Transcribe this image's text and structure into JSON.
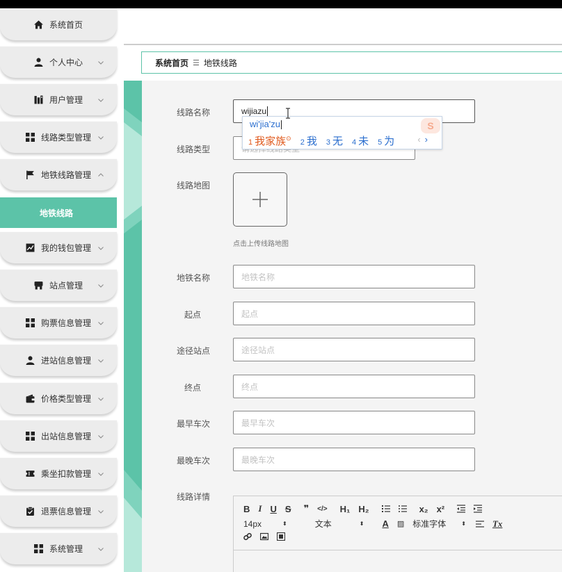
{
  "sidebar": {
    "items": [
      {
        "label": "系统首页",
        "icon": "home-icon",
        "expandable": false
      },
      {
        "label": "个人中心",
        "icon": "user-icon",
        "expandable": true
      },
      {
        "label": "用户管理",
        "icon": "building-icon",
        "expandable": true
      },
      {
        "label": "线路类型管理",
        "icon": "grid-icon",
        "expandable": true
      },
      {
        "label": "地铁线路管理",
        "icon": "flag-icon",
        "expandable": true,
        "expanded": true
      },
      {
        "label": "我的钱包管理",
        "icon": "chart-icon",
        "expandable": true
      },
      {
        "label": "站点管理",
        "icon": "store-icon",
        "expandable": true
      },
      {
        "label": "购票信息管理",
        "icon": "grid-icon",
        "expandable": true
      },
      {
        "label": "进站信息管理",
        "icon": "user-icon",
        "expandable": true
      },
      {
        "label": "价格类型管理",
        "icon": "wallet-icon",
        "expandable": true
      },
      {
        "label": "出站信息管理",
        "icon": "grid-icon",
        "expandable": true
      },
      {
        "label": "乘坐扣款管理",
        "icon": "ticket-icon",
        "expandable": true
      },
      {
        "label": "退票信息管理",
        "icon": "clipboard-icon",
        "expandable": true
      },
      {
        "label": "系统管理",
        "icon": "grid-icon",
        "expandable": true
      }
    ],
    "active_sub": "地铁线路"
  },
  "breadcrumb": {
    "home": "系统首页",
    "separator": "☰",
    "current": "地铁线路"
  },
  "form": {
    "fields": {
      "line_name": {
        "label": "线路名称",
        "value": "wijiazu"
      },
      "line_type": {
        "label": "线路类型",
        "placeholder": "请选择线路类型"
      },
      "line_map": {
        "label": "线路地图",
        "tip": "点击上传线路地图"
      },
      "subway_name": {
        "label": "地铁名称",
        "placeholder": "地铁名称"
      },
      "start": {
        "label": "起点",
        "placeholder": "起点"
      },
      "via": {
        "label": "途径站点",
        "placeholder": "途径站点"
      },
      "end": {
        "label": "终点",
        "placeholder": "终点"
      },
      "first_train": {
        "label": "最早车次",
        "placeholder": "最早车次"
      },
      "last_train": {
        "label": "最晚车次",
        "placeholder": "最晚车次"
      },
      "details": {
        "label": "线路详情"
      }
    }
  },
  "ime": {
    "pinyin": "wi'jia'zu",
    "candidates": [
      {
        "n": "1",
        "text": "我家族"
      },
      {
        "n": "2",
        "text": "我"
      },
      {
        "n": "3",
        "text": "无"
      },
      {
        "n": "4",
        "text": "未"
      },
      {
        "n": "5",
        "text": "为"
      }
    ],
    "logo": "S"
  },
  "editor": {
    "font_size": "14px",
    "paragraph": "文本",
    "font_family": "标准字体",
    "h1": "H₁",
    "h2": "H₂",
    "sub": "x₂",
    "sup": "x²",
    "quote": "❞",
    "code": "</>"
  },
  "colors": {
    "accent": "#5cc3a8",
    "ime_blue": "#2c6fcf",
    "ime_orange": "#e05a1e"
  }
}
